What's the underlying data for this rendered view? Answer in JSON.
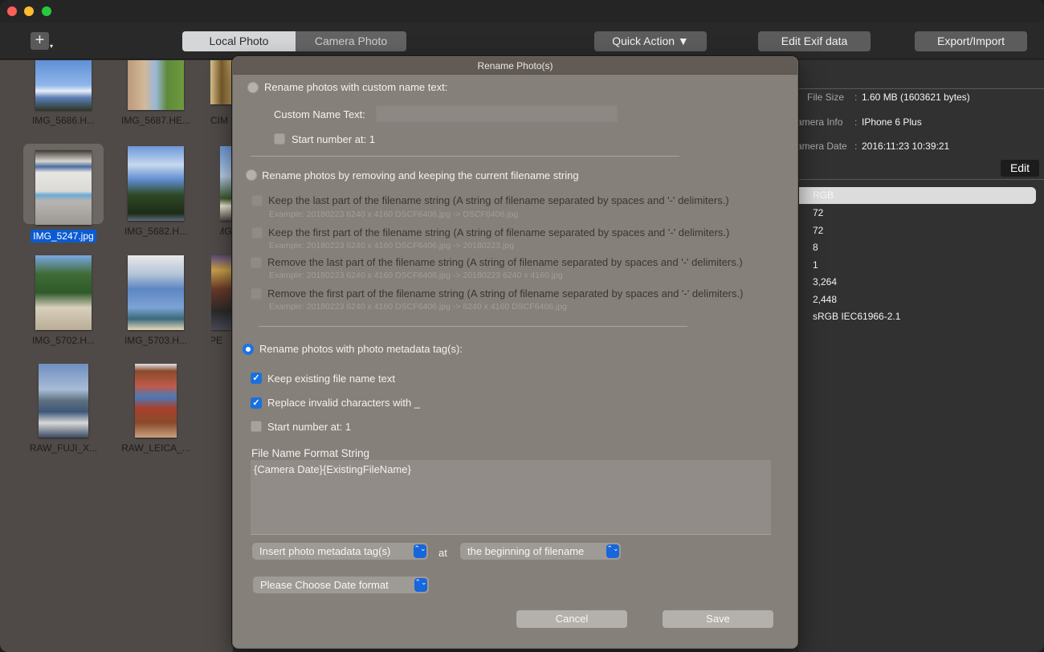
{
  "toolbar": {
    "add_label": "+",
    "add_caret": "▾",
    "tabs": [
      {
        "label": "Local Photo",
        "active": true
      },
      {
        "label": "Camera Photo",
        "active": false
      }
    ],
    "quick_action_label": "Quick Action ▼",
    "edit_exif_label": "Edit Exif data",
    "export_import_label": "Export/Import"
  },
  "browser": {
    "items": [
      {
        "label": "IMG_5686.H...",
        "selected": false
      },
      {
        "label": "IMG_5687.HE...",
        "selected": false
      },
      {
        "label": "CIM",
        "selected": false
      },
      {
        "label": "IMG_5247.jpg",
        "selected": true
      },
      {
        "label": "IMG_5682.H...",
        "selected": false
      },
      {
        "label": "IMG",
        "selected": false
      },
      {
        "label": "IMG_5702.H...",
        "selected": false
      },
      {
        "label": "IMG_5703.H...",
        "selected": false
      },
      {
        "label": "JPE",
        "selected": false
      },
      {
        "label": "RAW_FUJI_X...",
        "selected": false
      },
      {
        "label": "RAW_LEICA_...",
        "selected": false
      }
    ]
  },
  "info": {
    "file_size_key": "File Size",
    "file_size_val": "1.60 MB (1603621 bytes)",
    "camera_info_key": "amera Info",
    "camera_info_val": "IPhone 6 Plus",
    "camera_date_key": "amera Date",
    "camera_date_val": "2016:11:23 10:39:21",
    "colon": ":",
    "edit_label": "Edit",
    "exif_values": [
      "RGB",
      "72",
      "72",
      "8",
      "1",
      "3,264",
      "2,448",
      "sRGB IEC61966-2.1"
    ]
  },
  "dialog": {
    "title": "Rename Photo(s)",
    "opt1": {
      "label": "Rename photos with custom name text:",
      "custom_name_label": "Custom Name Text:",
      "custom_name_value": "",
      "start_number_label": "Start number at: 1"
    },
    "opt2": {
      "label": "Rename photos by removing and keeping the current filename string",
      "items": [
        {
          "label": "Keep the last part of the filename string (A string of filename separated by spaces and '-' delimiters.)",
          "example": "Example: 20180223  6240 x 4160 DSCF6406.jpg  ->  DSCF6406.jpg"
        },
        {
          "label": "Keep the first part of the filename string (A string of filename separated by spaces and '-' delimiters.)",
          "example": "Example: 20180223  6240 x 4160 DSCF6406.jpg  ->  20180223.jpg"
        },
        {
          "label": "Remove the last part of the filename string (A string of filename separated by spaces and '-' delimiters.)",
          "example": "Example: 20180223  6240 x 4160 DSCF6406.jpg  -> 20180223  6240 x 4160.jpg"
        },
        {
          "label": "Remove the first part of the filename string (A string of filename separated by spaces and '-' delimiters.)",
          "example": "Example: 20180223  6240 x 4160 DSCF6406.jpg  -> 6240 x 4160 DSCF6406.jpg"
        }
      ]
    },
    "opt3": {
      "label": "Rename photos with photo metadata tag(s):",
      "keep_existing_label": "Keep existing file name text",
      "replace_invalid_label": "Replace invalid characters with _",
      "start_number_label": "Start number at: 1",
      "format_string_label": "File Name Format String",
      "format_string_value": "{Camera Date}{ExistingFileName}",
      "insert_tag_popup": "Insert photo metadata tag(s)",
      "at_label": "at",
      "position_popup": "the beginning of filename",
      "date_format_popup": "Please Choose Date format",
      "popup_arrows": "⌃⌄"
    },
    "cancel_label": "Cancel",
    "save_label": "Save",
    "checkmark": "✓"
  }
}
